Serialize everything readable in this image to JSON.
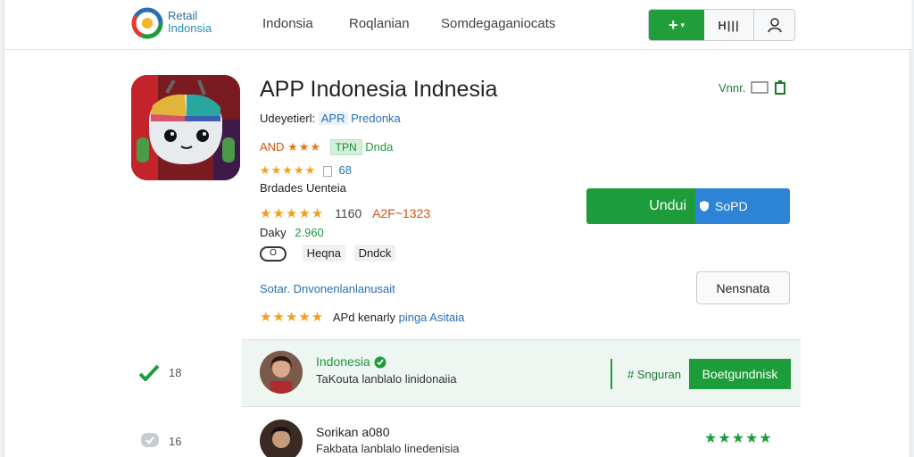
{
  "header": {
    "brand_line1": "Retail",
    "brand_line2": "Indonsia",
    "nav": [
      "Indonsia",
      "Roqlanian",
      "Somdegaganiocats"
    ],
    "plus_label": "+",
    "plus_caret": "▾",
    "bars_label": "H|||"
  },
  "app": {
    "title": "APP Indonesia Indnesia",
    "developer_label": "Udeyetierl:",
    "developer_value": "APR",
    "developer_link": "Predonka",
    "badge_text": "AND",
    "badge_stars": "★★★",
    "pill": "TPN",
    "pill_after": "Dnda",
    "rating_stars_1": "★★★★★",
    "rating_count_1": "68",
    "category": "Brdades Uenteia",
    "rating_stars_2": "★★★★★",
    "rating_num": "1160",
    "rating_range": "A2F~1323",
    "price_label": "Daky",
    "price_value": "2.960",
    "toggle_label": "O",
    "tags": [
      "Heqna",
      "Dndck"
    ],
    "support_text": "Sotar. Dnvonenlanlanusait",
    "rating_stars_3": "★★★★★",
    "rating_text": "APd kenarly",
    "rating_link": "pinga Asitaia",
    "top_right_text": "Vnnr."
  },
  "actions": {
    "download_label": "Undui",
    "download_secondary": "SoPD",
    "secondary_button": "Nensnata"
  },
  "reviews": [
    {
      "side_value": "18",
      "name": "Indonesia",
      "text": "TaKouta lanblalo linidonaiia",
      "side_label": "# Snguran",
      "button": "Boetgundnisk"
    },
    {
      "side_value": "16",
      "name": "Sorikan a080",
      "text": "Fakbata lanblalo linedenisia",
      "stars": "★★★★★"
    }
  ],
  "colors": {
    "green": "#1d9c3b",
    "blue": "#2d83d6",
    "star": "#f0a020"
  }
}
